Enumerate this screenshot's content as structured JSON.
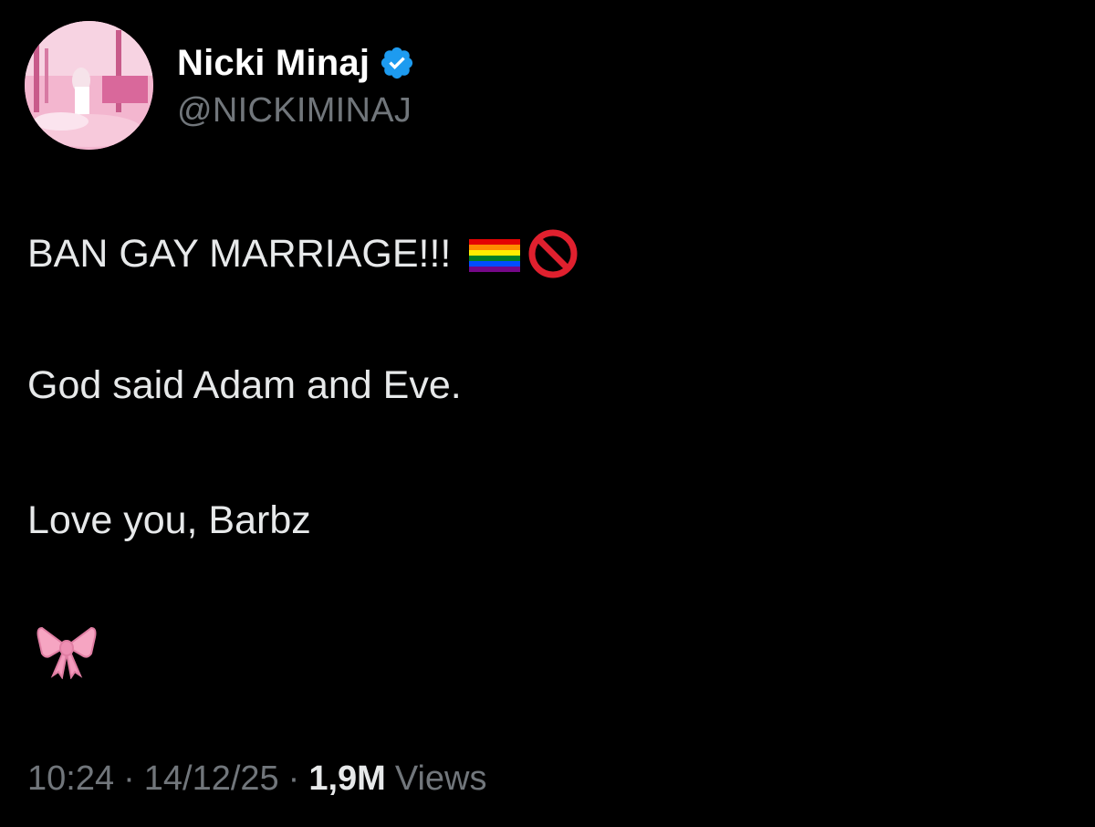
{
  "author": {
    "display_name": "Nicki Minaj",
    "handle": "@NICKIMINAJ",
    "verified": true,
    "verified_icon": "verified-badge-icon",
    "avatar": "profile-avatar-image"
  },
  "tweet": {
    "line1_text": "BAN GAY MARRIAGE!!!",
    "line1_emojis": [
      "rainbow-flag-icon",
      "prohibited-icon"
    ],
    "line2_text": "God said Adam and Eve.",
    "line3_text": "Love you, Barbz",
    "line4_emoji": "pink-ribbon-icon"
  },
  "meta": {
    "time": "10:24",
    "date": "14/12/25",
    "views_count": "1,9M",
    "views_label": "Views",
    "separator": "·"
  },
  "colors": {
    "background": "#000000",
    "primary_text": "#e7e9ea",
    "secondary_text": "#71767b",
    "verified_blue": "#1d9bf0"
  }
}
